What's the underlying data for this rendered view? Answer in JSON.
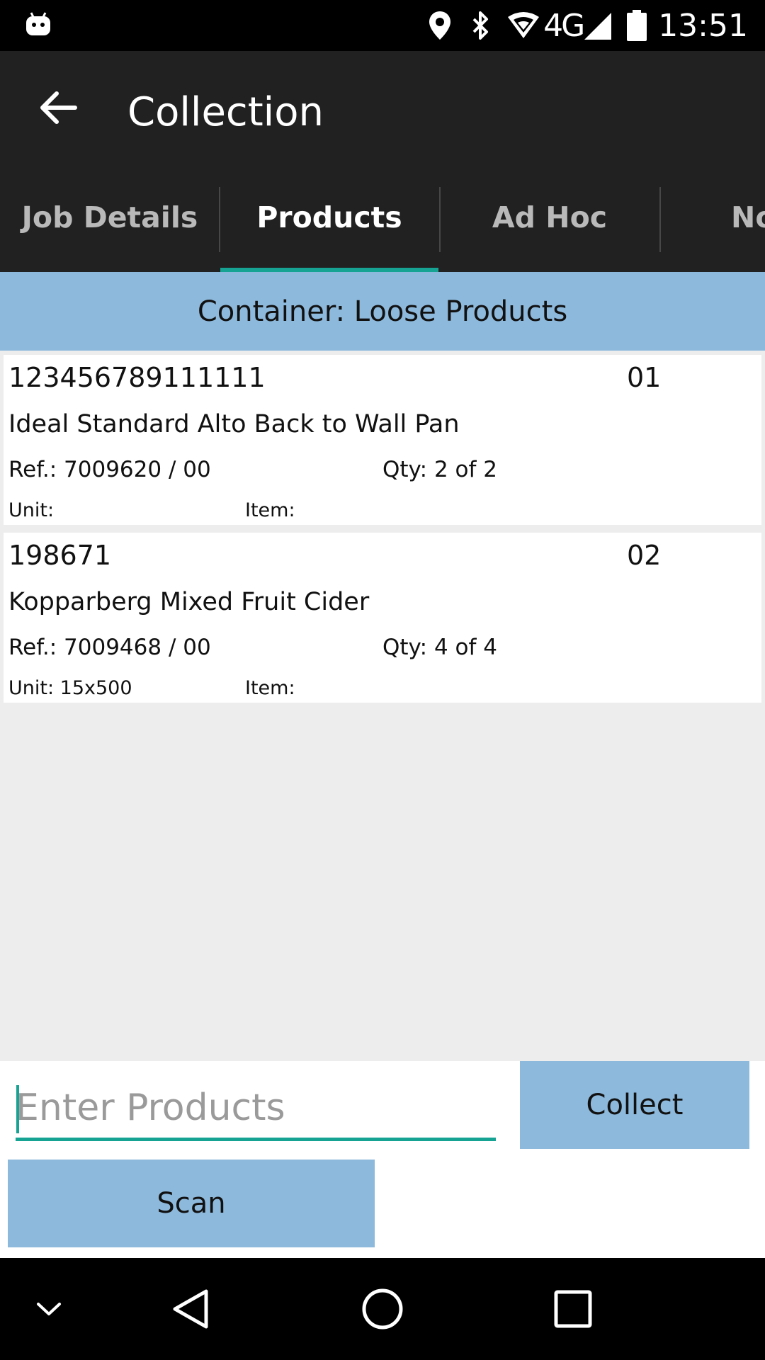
{
  "status_bar": {
    "time": "13:51",
    "network": "4G",
    "icons": [
      "android-robot-icon",
      "location-icon",
      "bluetooth-icon",
      "wifi-icon",
      "signal-icon",
      "battery-icon"
    ]
  },
  "app_bar": {
    "back_icon": "arrow-back-icon",
    "title": "Collection"
  },
  "tabs": [
    {
      "label": "Job Details",
      "active": false
    },
    {
      "label": "Products",
      "active": true
    },
    {
      "label": "Ad Hoc",
      "active": false
    },
    {
      "label": "No",
      "active": false
    }
  ],
  "container": {
    "title": "Container: Loose Products"
  },
  "products": [
    {
      "code": "123456789111111",
      "line": "01",
      "name": "Ideal Standard Alto Back to Wall Pan",
      "ref": "Ref.: 7009620 / 00",
      "qty": "Qty: 2 of 2",
      "unit": "Unit:",
      "item": "Item:"
    },
    {
      "code": "198671",
      "line": "02",
      "name": "Kopparberg Mixed Fruit Cider",
      "ref": "Ref.: 7009468 / 00",
      "qty": "Qty: 4 of 4",
      "unit": "Unit: 15x500",
      "item": "Item:"
    }
  ],
  "entry": {
    "placeholder": "Enter Products",
    "value": "",
    "collect_label": "Collect",
    "scan_label": "Scan"
  },
  "colors": {
    "accent": "#16a393",
    "button": "#8db9dc",
    "header_bar": "#212121"
  },
  "nav_bar": {
    "icons": [
      "chevron-down-icon",
      "back-triangle-icon",
      "home-circle-icon",
      "recents-square-icon"
    ]
  }
}
